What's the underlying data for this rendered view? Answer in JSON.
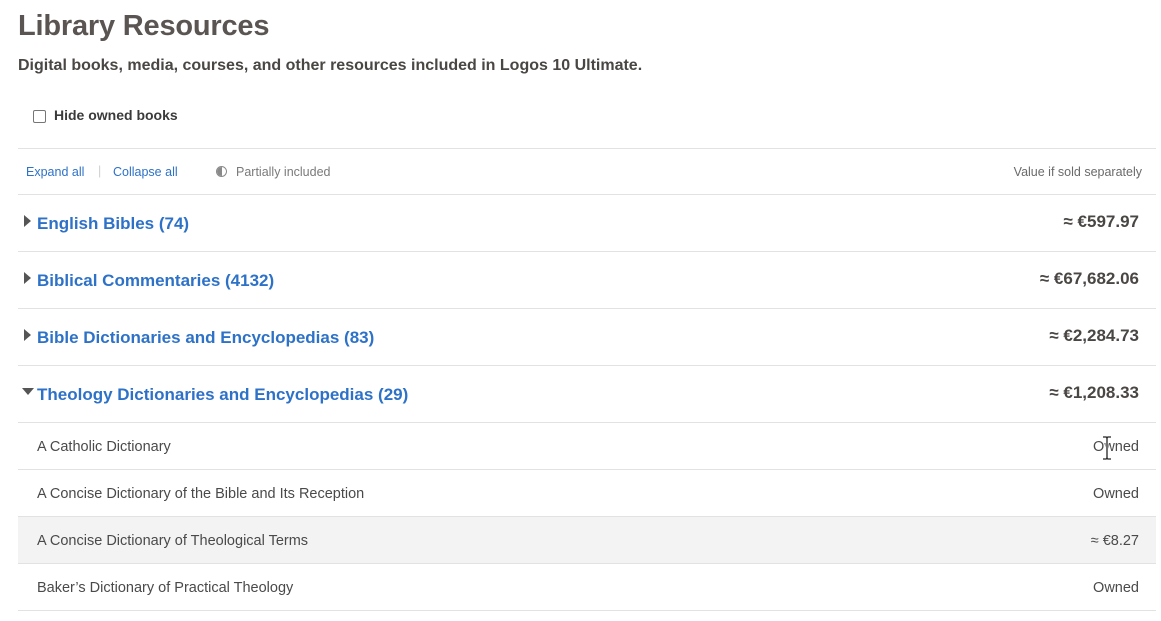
{
  "header": {
    "title": "Library Resources",
    "subtitle": "Digital books, media, courses, and other resources included in Logos 10 Ultimate."
  },
  "filters": {
    "hide_owned_label": "Hide owned books",
    "hide_owned_checked": false
  },
  "toolbar": {
    "expand_all": "Expand all",
    "separator": "|",
    "collapse_all": "Collapse all",
    "partially_included": "Partially included",
    "value_header": "Value if sold separately"
  },
  "categories": [
    {
      "name": "English Bibles (74)",
      "value": "≈ €597.97",
      "expanded": false
    },
    {
      "name": "Biblical Commentaries (4132)",
      "value": "≈ €67,682.06",
      "expanded": false
    },
    {
      "name": "Bible Dictionaries and Encyclopedias (83)",
      "value": "≈ €2,284.73",
      "expanded": false
    },
    {
      "name": "Theology Dictionaries and Encyclopedias (29)",
      "value": "≈ €1,208.33",
      "expanded": true
    }
  ],
  "items": [
    {
      "name": "A Catholic Dictionary",
      "value": "Owned"
    },
    {
      "name": "A Concise Dictionary of the Bible and Its Reception",
      "value": "Owned"
    },
    {
      "name": "A Concise Dictionary of Theological Terms",
      "value": "≈ €8.27"
    },
    {
      "name": "Baker’s Dictionary of Practical Theology",
      "value": "Owned"
    }
  ],
  "colors": {
    "link": "#2e72c8",
    "title": "#5a5553",
    "row_highlight": "#f3f3f3"
  }
}
